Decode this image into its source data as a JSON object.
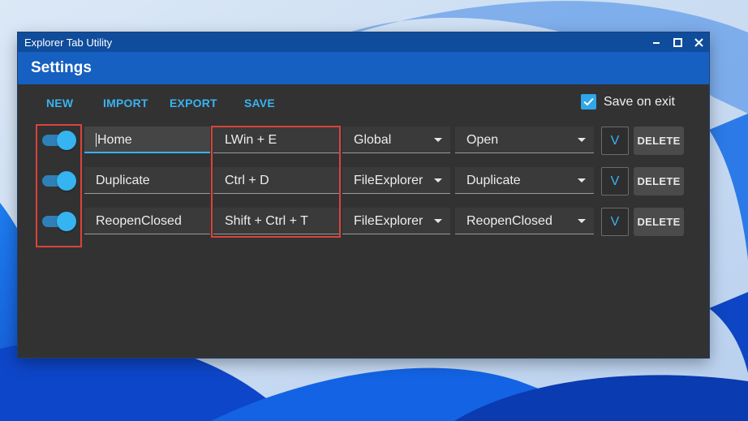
{
  "window": {
    "title": "Explorer Tab Utility",
    "controls": [
      "minimize-icon",
      "maximize-icon",
      "close-icon"
    ]
  },
  "header": {
    "title": "Settings"
  },
  "toolbar": {
    "new_label": "NEW",
    "import_label": "IMPORT",
    "export_label": "EXPORT",
    "save_label": "SAVE",
    "save_on_exit_label": "Save on exit",
    "save_on_exit_checked": true
  },
  "rows": [
    {
      "enabled": true,
      "name": "Home",
      "hotkey": "LWin + E",
      "scope": "Global",
      "action": "Open",
      "expand_label": "V",
      "delete_label": "DELETE"
    },
    {
      "enabled": true,
      "name": "Duplicate",
      "hotkey": "Ctrl + D",
      "scope": "FileExplorer",
      "action": "Duplicate",
      "expand_label": "V",
      "delete_label": "DELETE"
    },
    {
      "enabled": true,
      "name": "ReopenClosed",
      "hotkey": "Shift + Ctrl + T",
      "scope": "FileExplorer",
      "action": "ReopenClosed",
      "expand_label": "V",
      "delete_label": "DELETE"
    }
  ],
  "colors": {
    "titlebar": "#0f4c9c",
    "header": "#1560c1",
    "accent": "#35b4f1",
    "window_bg": "#323232",
    "highlight_box": "#d9443b"
  }
}
